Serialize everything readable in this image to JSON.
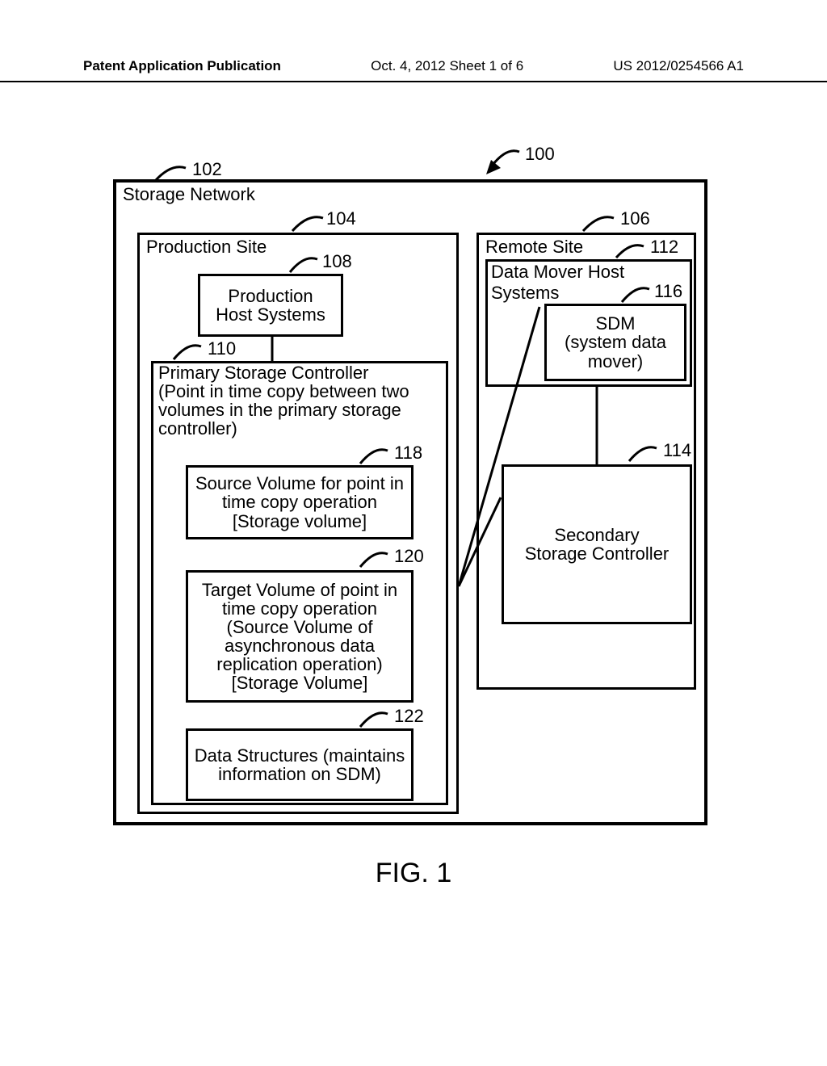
{
  "header": {
    "left": "Patent Application Publication",
    "center": "Oct. 4, 2012  Sheet 1 of 6",
    "right": "US 2012/0254566 A1"
  },
  "refs": {
    "r100": "100",
    "r102": "102",
    "r104": "104",
    "r106": "106",
    "r108": "108",
    "r110": "110",
    "r112": "112",
    "r114": "114",
    "r116": "116",
    "r118": "118",
    "r120": "120",
    "r122": "122"
  },
  "labels": {
    "storage_network": "Storage Network",
    "production_site": "Production Site",
    "production_host": "Production\nHost Systems",
    "primary_controller": "Primary Storage Controller\n(Point in time copy between two volumes in the primary storage controller)",
    "src_volume": "Source Volume for point in time copy operation [Storage volume]",
    "tgt_volume": "Target Volume of point in time copy operation (Source Volume of asynchronous data replication operation) [Storage Volume]",
    "data_structures": "Data Structures (maintains information on SDM)",
    "remote_site": "Remote Site",
    "dm_host": "Data Mover Host Systems",
    "sdm": "SDM\n(system data\nmover)",
    "secondary_controller": "Secondary\nStorage Controller"
  },
  "figure_caption": "FIG. 1"
}
